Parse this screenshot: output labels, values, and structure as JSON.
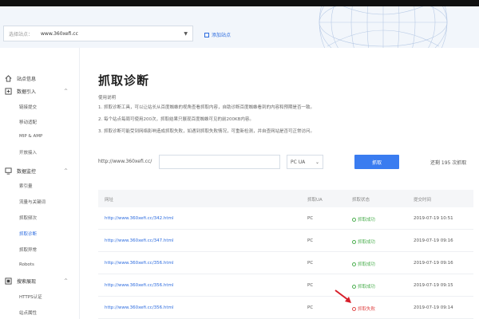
{
  "header": {
    "site_label": "选择站点：",
    "site_value": "www.360xefi.cc",
    "add_site": "添加站点"
  },
  "sidebar": {
    "sections": [
      {
        "label": "站点信息"
      },
      {
        "label": "数据引入",
        "items": [
          "链接提交",
          "移动适配",
          "MIP & AMP",
          "开放接入"
        ]
      },
      {
        "label": "数据监控",
        "items": [
          "索引量",
          "流量与关键词",
          "抓取频次",
          "抓取诊断",
          "抓取异常",
          "Robots"
        ]
      },
      {
        "label": "搜索展现",
        "items": [
          "HTTPS认证",
          "站点属性"
        ]
      }
    ]
  },
  "main": {
    "title": "抓取诊断",
    "usage_title": "使用说明",
    "desc_lines": [
      "1. 抓取诊断工具，可以让站长从百度蜘蛛的视角查看抓取内容，自助诊断百度蜘蛛看到的内容和预期是否一致。",
      "2. 每个站点每周可使用200次，抓取结果只展现百度蜘蛛可见的前200KB内容。",
      "3. 抓取诊断可能受到网络影响造成抓取失败，如遇到抓取失败情况，可重新检测，并自查网站是否可正常访问。"
    ],
    "url_prefix": "http://www.360xefi.cc/",
    "ua_value": "PC UA",
    "fetch_button": "抓取",
    "remaining": "还剩 195 次抓取"
  },
  "table": {
    "headers": [
      "网址",
      "抓取UA",
      "抓取状态",
      "提交时间"
    ],
    "rows": [
      {
        "url": "http://www.360xefi.cc/342.html",
        "ua": "PC",
        "status": "抓取成功",
        "time": "2019-07-19 10:51"
      },
      {
        "url": "http://www.360xefi.cc/347.html",
        "ua": "PC",
        "status": "抓取成功",
        "time": "2019-07-19 09:16"
      },
      {
        "url": "http://www.360xefi.cc/356.html",
        "ua": "PC",
        "status": "抓取成功",
        "time": "2019-07-19 09:16"
      },
      {
        "url": "http://www.360xefi.cc/356.html",
        "ua": "PC",
        "status": "抓取成功",
        "time": "2019-07-19 09:15"
      },
      {
        "url": "http://www.360xefi.cc/356.html",
        "ua": "PC",
        "status": "抓取失败",
        "time": "2019-07-19 09:14"
      }
    ]
  },
  "colors": {
    "accent": "#3a7cf0",
    "link": "#2d6cdf",
    "success": "#4caf50",
    "fail": "#e04848",
    "arrow": "#d81e2a"
  },
  "icons": {
    "home": "home-icon",
    "import": "import-icon",
    "monitor": "monitor-icon",
    "search": "search-display-icon"
  }
}
